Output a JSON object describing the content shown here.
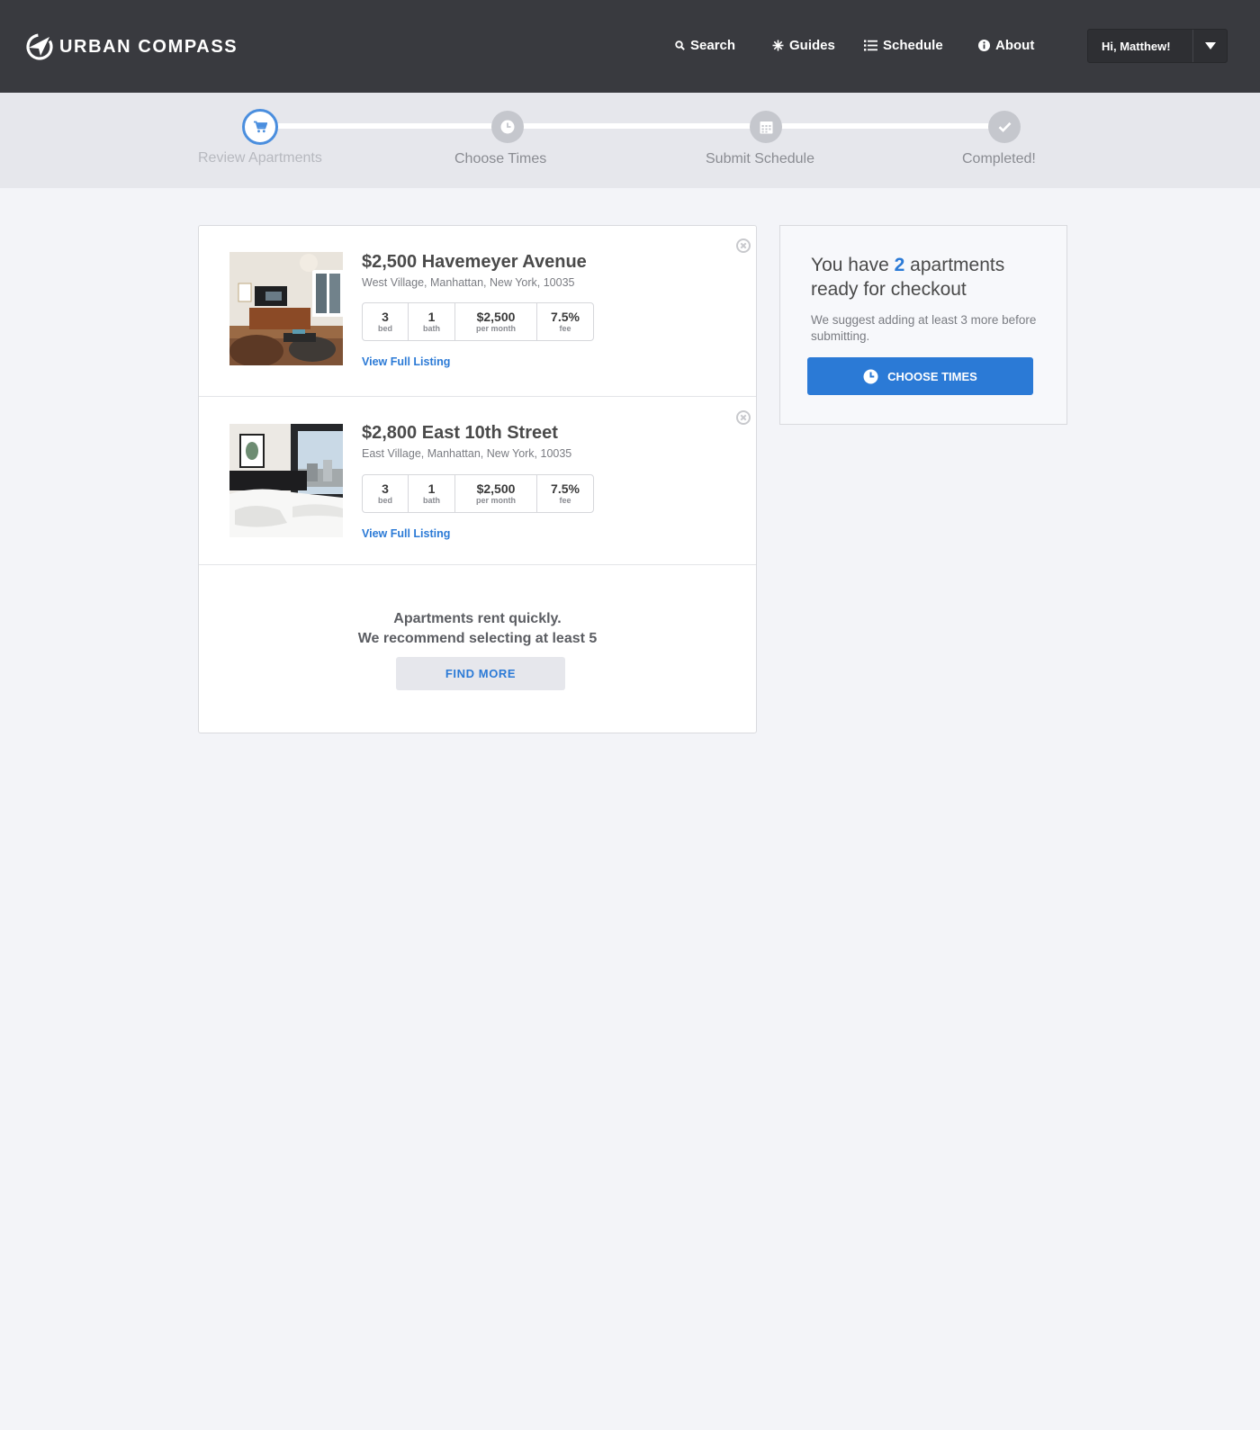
{
  "header": {
    "brand": "URBAN COMPASS",
    "nav": [
      {
        "label": "Search",
        "icon": "search-icon"
      },
      {
        "label": "Guides",
        "icon": "sparkle-icon"
      },
      {
        "label": "Schedule",
        "icon": "list-icon"
      },
      {
        "label": "About",
        "icon": "info-icon"
      }
    ],
    "user_greeting": "Hi, Matthew!"
  },
  "steps": [
    {
      "label": "Review Apartments",
      "icon": "cart-icon",
      "active": true
    },
    {
      "label": "Choose Times",
      "icon": "clock-icon",
      "active": false
    },
    {
      "label": "Submit Schedule",
      "icon": "calendar-icon",
      "active": false
    },
    {
      "label": "Completed!",
      "icon": "check-icon",
      "active": false
    }
  ],
  "listings": [
    {
      "title": "$2,500 Havemeyer Avenue",
      "address": "West Village, Manhattan, New York, 10035",
      "stats": [
        {
          "value": "3",
          "unit": "bed"
        },
        {
          "value": "1",
          "unit": "bath"
        },
        {
          "value": "$2,500",
          "unit": "per month"
        },
        {
          "value": "7.5%",
          "unit": "fee"
        }
      ],
      "link": "View Full Listing"
    },
    {
      "title": "$2,800 East 10th Street",
      "address": "East Village, Manhattan, New York, 10035",
      "stats": [
        {
          "value": "3",
          "unit": "bed"
        },
        {
          "value": "1",
          "unit": "bath"
        },
        {
          "value": "$2,500",
          "unit": "per month"
        },
        {
          "value": "7.5%",
          "unit": "fee"
        }
      ],
      "link": "View Full Listing"
    }
  ],
  "recommend": {
    "line1": "Apartments rent quickly.",
    "line2": "We recommend selecting at least 5",
    "button": "FIND MORE"
  },
  "checkout": {
    "title_pre": "You have ",
    "count": "2",
    "title_post": " apartments ready for checkout",
    "subtitle": "We suggest adding at least 3 more before submitting.",
    "button": "CHOOSE TIMES"
  },
  "colors": {
    "header_bg": "#393a3f",
    "accent": "#2b7ad6",
    "page_bg": "#f3f4f8"
  }
}
